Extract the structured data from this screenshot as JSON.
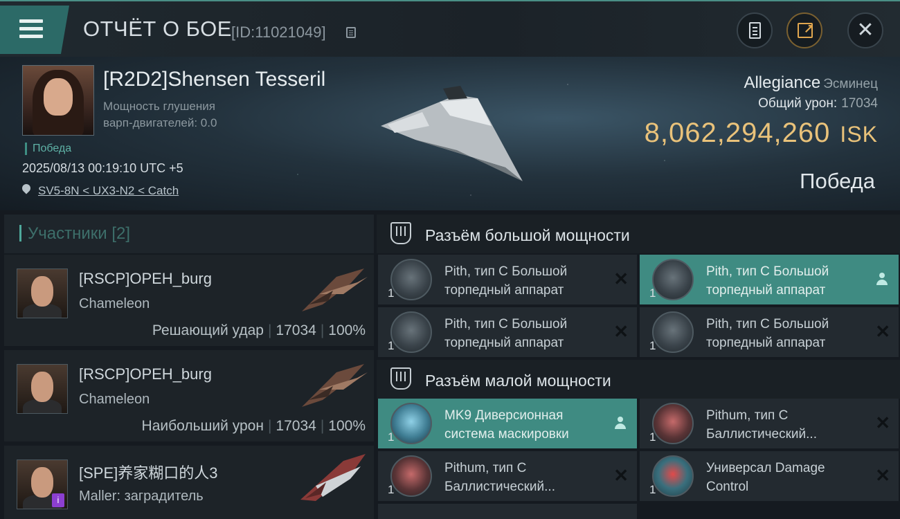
{
  "header": {
    "title": "ОТЧЁТ О БОЕ",
    "report_id": "[ID:11021049]"
  },
  "victim": {
    "name": "[R2D2]Shensen Tesseril",
    "jam_label_1": "Мощность глушения",
    "jam_label_2": "варп-двигателей: 0.0",
    "status": "Победа",
    "datetime": "2025/08/13 00:19:10 UTC +5",
    "location": "SV5-8N < UX3-N2 < Catch",
    "ship": "Allegiance",
    "ship_class": "Эсминец",
    "total_damage_label": "Общий урон:",
    "total_damage": "17034",
    "isk_value": "8,062,294,260",
    "isk_unit": "ISK",
    "result": "Победа"
  },
  "participants": {
    "title": "Участники [2]",
    "items": [
      {
        "name": "[RSCP]OPEH_burg",
        "ship": "Chameleon",
        "role": "Решающий удар",
        "damage": "17034",
        "percent": "100%"
      },
      {
        "name": "[RSCP]OPEH_burg",
        "ship": "Chameleon",
        "role": "Наибольший урон",
        "damage": "17034",
        "percent": "100%"
      },
      {
        "name": "[SPE]养家糊口的人3",
        "ship": "Maller: заградитель"
      }
    ]
  },
  "fittings": {
    "high_title": "Разъём большой мощности",
    "low_title": "Разъём малой мощности",
    "high_slots": [
      {
        "line1": "Pith, тип C Большой",
        "line2": "торпедный аппарат",
        "qty": "1"
      },
      {
        "line1": "Pith, тип C Большой",
        "line2": "торпедный аппарат",
        "qty": "1"
      },
      {
        "line1": "Pith, тип C Большой",
        "line2": "торпедный аппарат",
        "qty": "1"
      },
      {
        "line1": "Pith, тип C Большой",
        "line2": "торпедный аппарат",
        "qty": "1"
      }
    ],
    "low_slots": [
      {
        "line1": "MK9 Диверсионная",
        "line2": "система маскировки",
        "qty": "1"
      },
      {
        "line1": "Pithum, тип C",
        "line2": "Баллистический...",
        "qty": "1"
      },
      {
        "line1": "Pithum, тип C",
        "line2": "Баллистический...",
        "qty": "1"
      },
      {
        "line1": "Универсал Damage",
        "line2": "Control",
        "qty": "1"
      }
    ]
  },
  "colors": {
    "accent_teal": "#3f8b82",
    "isk_gold": "#e9c27a",
    "background": "#151a20"
  }
}
